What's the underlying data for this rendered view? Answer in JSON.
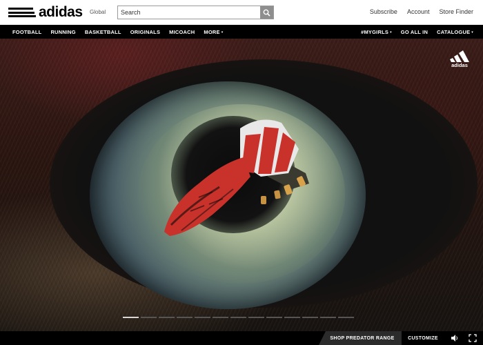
{
  "header": {
    "logo_text": "adidas",
    "region": "Global",
    "search": {
      "placeholder": "Search"
    },
    "links": [
      "Subscribe",
      "Account",
      "Store Finder"
    ]
  },
  "nav": {
    "left": [
      {
        "label": "FOOTBALL",
        "has_caret": false
      },
      {
        "label": "RUNNING",
        "has_caret": false
      },
      {
        "label": "BASKETBALL",
        "has_caret": false
      },
      {
        "label": "ORIGINALS",
        "has_caret": false
      },
      {
        "label": "MICOACH",
        "has_caret": false
      },
      {
        "label": "MORE",
        "has_caret": true
      }
    ],
    "right": [
      {
        "label": "#MYGIRLS",
        "has_caret": true
      },
      {
        "label": "GO ALL IN",
        "has_caret": false
      },
      {
        "label": "CATALOGUE",
        "has_caret": true
      }
    ],
    "caret_glyph": "▾"
  },
  "hero": {
    "logo_text": "adidas",
    "slides_total": 13,
    "active_slide": 1
  },
  "footer_bar": {
    "shop_label": "SHOP PREDATOR RANGE",
    "customize_label": "CUSTOMIZE",
    "sound_icon": "speaker-icon",
    "fullscreen_icon": "fullscreen-icon"
  },
  "colors": {
    "header_bg": "#ffffff",
    "nav_bg": "#000000",
    "search_button": "#8e8e8e",
    "boot_red": "#c8322b",
    "boot_white": "#e8e8e8",
    "dot_active": "#d8d8d8",
    "dot_inactive": "#555555"
  }
}
